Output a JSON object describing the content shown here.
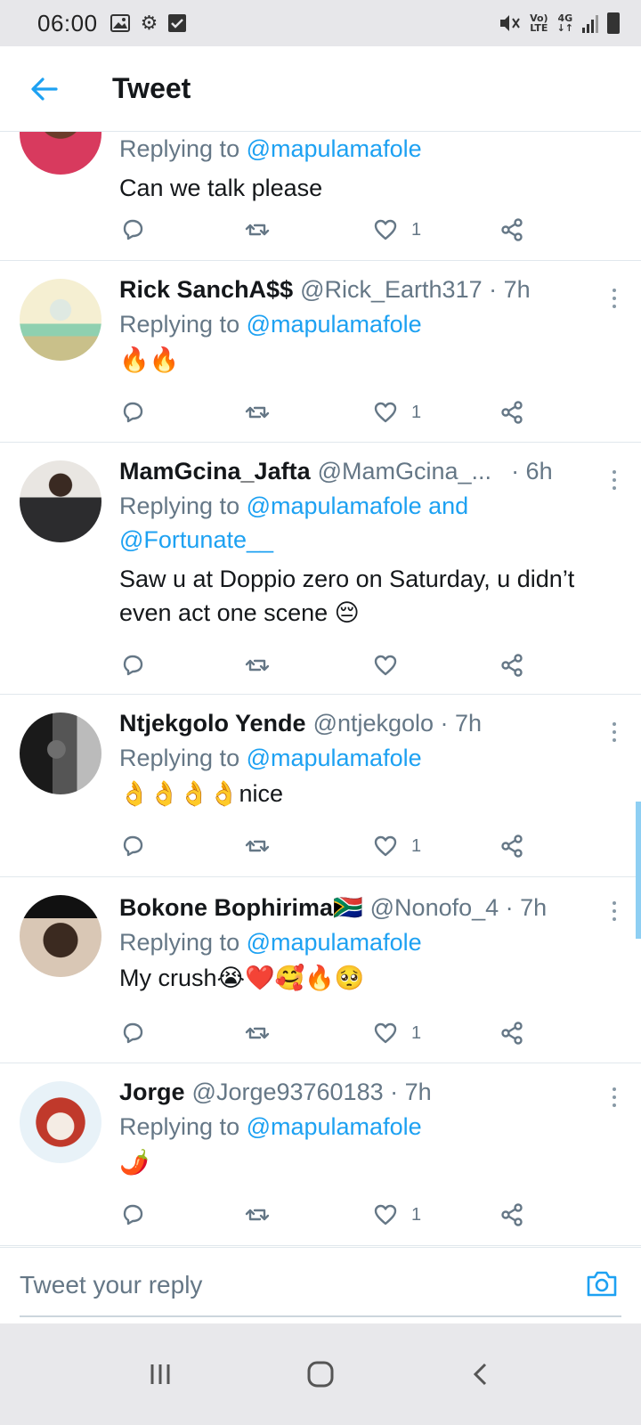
{
  "status_bar": {
    "time": "06:00",
    "volte": "Vo)\nLTE",
    "net": "4G"
  },
  "header": {
    "title": "Tweet"
  },
  "tweets": [
    {
      "name": "",
      "handle": "",
      "time": "",
      "replying_prefix": "Replying to ",
      "replying_to": "@mapulamafole",
      "text": "Can we talk please",
      "likes": "1"
    },
    {
      "name": "Rick SanchA$$",
      "handle": "@Rick_Earth317 · 7h",
      "replying_prefix": "Replying to ",
      "replying_to": "@mapulamafole",
      "text": "🔥🔥",
      "likes": "1"
    },
    {
      "name": "MamGcina_Jafta",
      "handle": "@MamGcina_...",
      "time": "· 6h",
      "replying_prefix": "Replying to ",
      "replying_to": "@mapulamafole and @Fortunate__",
      "text": "Saw u at Doppio zero on Saturday, u didn’t even act one scene 😔",
      "likes": ""
    },
    {
      "name": "Ntjekgolo Yende",
      "handle": "@ntjekgolo · 7h",
      "replying_prefix": "Replying to ",
      "replying_to": "@mapulamafole",
      "text": "👌👌👌👌nice",
      "likes": "1"
    },
    {
      "name": "Bokone Bophirima🇿🇦",
      "handle": "@Nonofo_4 · 7h",
      "replying_prefix": "Replying to ",
      "replying_to": "@mapulamafole",
      "text": "My crush😭❤️🥰🔥🥺",
      "likes": "1"
    },
    {
      "name": "Jorge",
      "handle": "@Jorge93760183 · 7h",
      "replying_prefix": "Replying to ",
      "replying_to": "@mapulamafole",
      "text": "🌶️",
      "likes": "1"
    }
  ],
  "reply_bar": {
    "placeholder": "Tweet your reply"
  },
  "colors": {
    "accent": "#1da1f2",
    "secondary_text": "#657786",
    "primary_text": "#14171a"
  }
}
